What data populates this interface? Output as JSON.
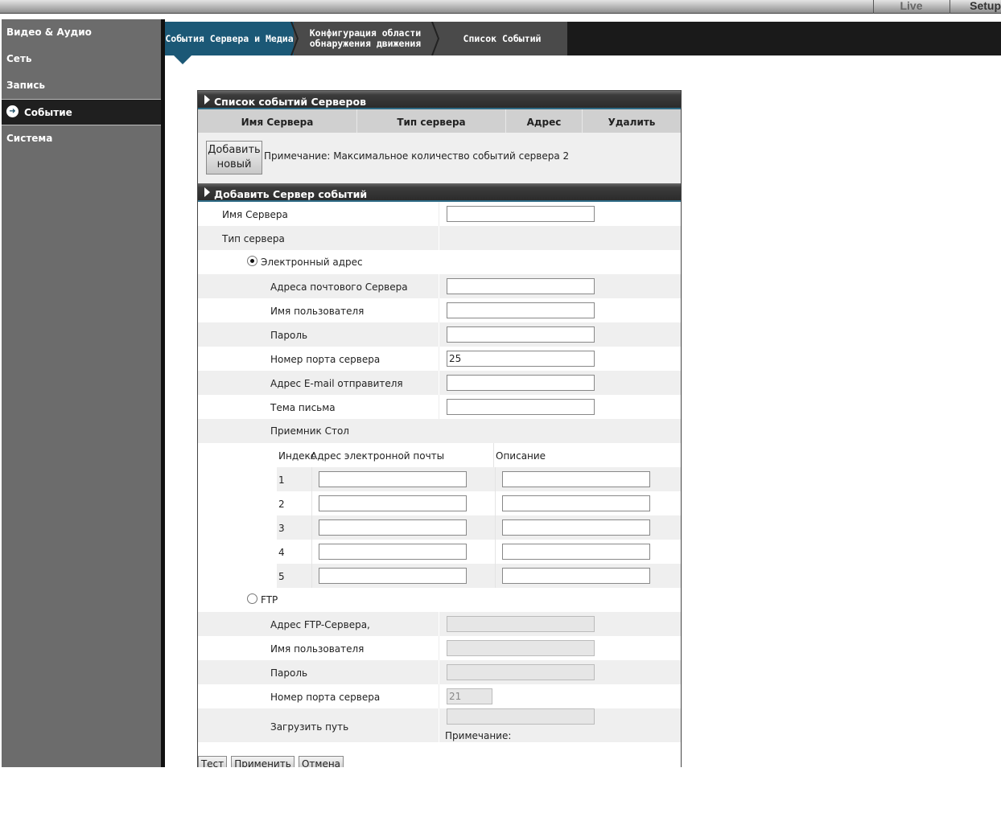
{
  "topbar": {
    "live_label": "Live",
    "setup_label": "Setup"
  },
  "sidebar": {
    "items": [
      {
        "label": "Видео & Аудио"
      },
      {
        "label": "Сеть"
      },
      {
        "label": "Запись"
      },
      {
        "label": "Событие",
        "icon": "arrow-right-circle-icon"
      },
      {
        "label": "Система"
      }
    ]
  },
  "tabs": [
    {
      "label": "События Сервера и Медиа"
    },
    {
      "label": "Конфигурация области обнаружения движения"
    },
    {
      "label": "Список Событий"
    }
  ],
  "server_list": {
    "title": "Список событий Серверов",
    "columns": [
      "Имя Сервера",
      "Тип сервера",
      "Адрес",
      "Удалить"
    ],
    "add_button": "Добавить новый",
    "note": "Примечание: Максимальное количество событий сервера 2"
  },
  "add_server": {
    "title": "Добавить Сервер событий",
    "server_name_label": "Имя Сервера",
    "server_name_value": "",
    "server_type_label": "Тип сервера",
    "email": {
      "option_label": "Электронный адрес",
      "selected": true,
      "fields": [
        {
          "label": "Адреса почтового Сервера",
          "value": ""
        },
        {
          "label": "Имя пользователя",
          "value": ""
        },
        {
          "label": "Пароль",
          "value": ""
        },
        {
          "label": "Номер порта сервера",
          "value": "25"
        },
        {
          "label": "Адрес E-mail отправителя",
          "value": ""
        },
        {
          "label": "Тема письма",
          "value": ""
        }
      ],
      "recipients_label": "Приемник Стол",
      "recipients_columns": [
        "Индекс",
        "Адрес электронной почты",
        "Описание"
      ],
      "recipients": [
        {
          "index": "1",
          "email": "",
          "description": ""
        },
        {
          "index": "2",
          "email": "",
          "description": ""
        },
        {
          "index": "3",
          "email": "",
          "description": ""
        },
        {
          "index": "4",
          "email": "",
          "description": ""
        },
        {
          "index": "5",
          "email": "",
          "description": ""
        }
      ]
    },
    "ftp": {
      "option_label": "FTP",
      "selected": false,
      "fields": [
        {
          "label": "Адрес FTP-Сервера,",
          "value": ""
        },
        {
          "label": "Имя пользователя",
          "value": ""
        },
        {
          "label": "Пароль",
          "value": ""
        },
        {
          "label": "Номер порта сервера",
          "value": "21"
        }
      ],
      "upload_path_label": "Загрузить путь",
      "upload_path_value": "",
      "upload_note": "Примечание:"
    }
  },
  "actions": {
    "test_label": "Тест",
    "apply_label": "Применить",
    "cancel_label": "Отмена"
  },
  "colors": {
    "accent": "#1b5876",
    "sidebar": "#6c6c6c"
  }
}
